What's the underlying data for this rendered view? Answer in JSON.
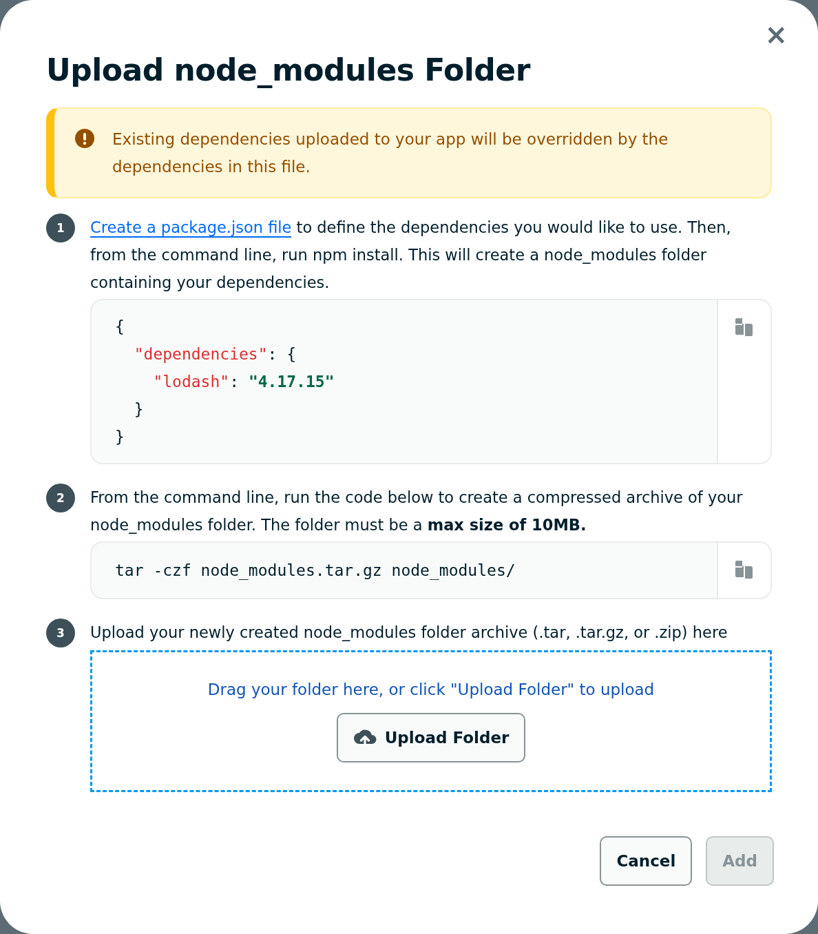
{
  "dialog": {
    "title": "Upload node_modules Folder",
    "close_label": "×"
  },
  "alert": {
    "text": "Existing dependencies uploaded to your app will be overridden by the dependencies in this file."
  },
  "steps": [
    {
      "number": "1",
      "link": "Create a package.json file",
      "text": " to define the dependencies you would like to use. Then, from the command line, run npm install. This will create a node_modules folder containing your dependencies.",
      "code": [
        [
          {
            "text": "{",
            "kind": "punct"
          }
        ],
        [
          {
            "text": "  \"dependencies\"",
            "kind": "key"
          },
          {
            "text": ": {",
            "kind": "punct"
          }
        ],
        [
          {
            "text": "    \"lodash\"",
            "kind": "key"
          },
          {
            "text": ": ",
            "kind": "punct"
          },
          {
            "text": "\"4.17.15\"",
            "kind": "string"
          }
        ],
        [
          {
            "text": "  }",
            "kind": "punct"
          }
        ],
        [
          {
            "text": "}",
            "kind": "punct"
          }
        ]
      ]
    },
    {
      "number": "2",
      "text": "From the command line, run the code below to create a compressed archive of your node_modules folder. The folder must be a **max size of 10MB.**",
      "code": [
        [
          {
            "text": "tar -czf node_modules.tar.gz node_modules/",
            "kind": "punct"
          }
        ]
      ]
    },
    {
      "number": "3",
      "text": "Upload your newly created node_modules folder archive (.tar, .tar.gz, or .zip) here",
      "dropzone": {
        "hint": "Drag your folder here, or click \"Upload Folder\" to upload",
        "button": "Upload Folder"
      }
    }
  ],
  "buttons": [
    {
      "label": "Cancel",
      "disabled": false
    },
    {
      "label": "Add",
      "disabled": true
    }
  ]
}
